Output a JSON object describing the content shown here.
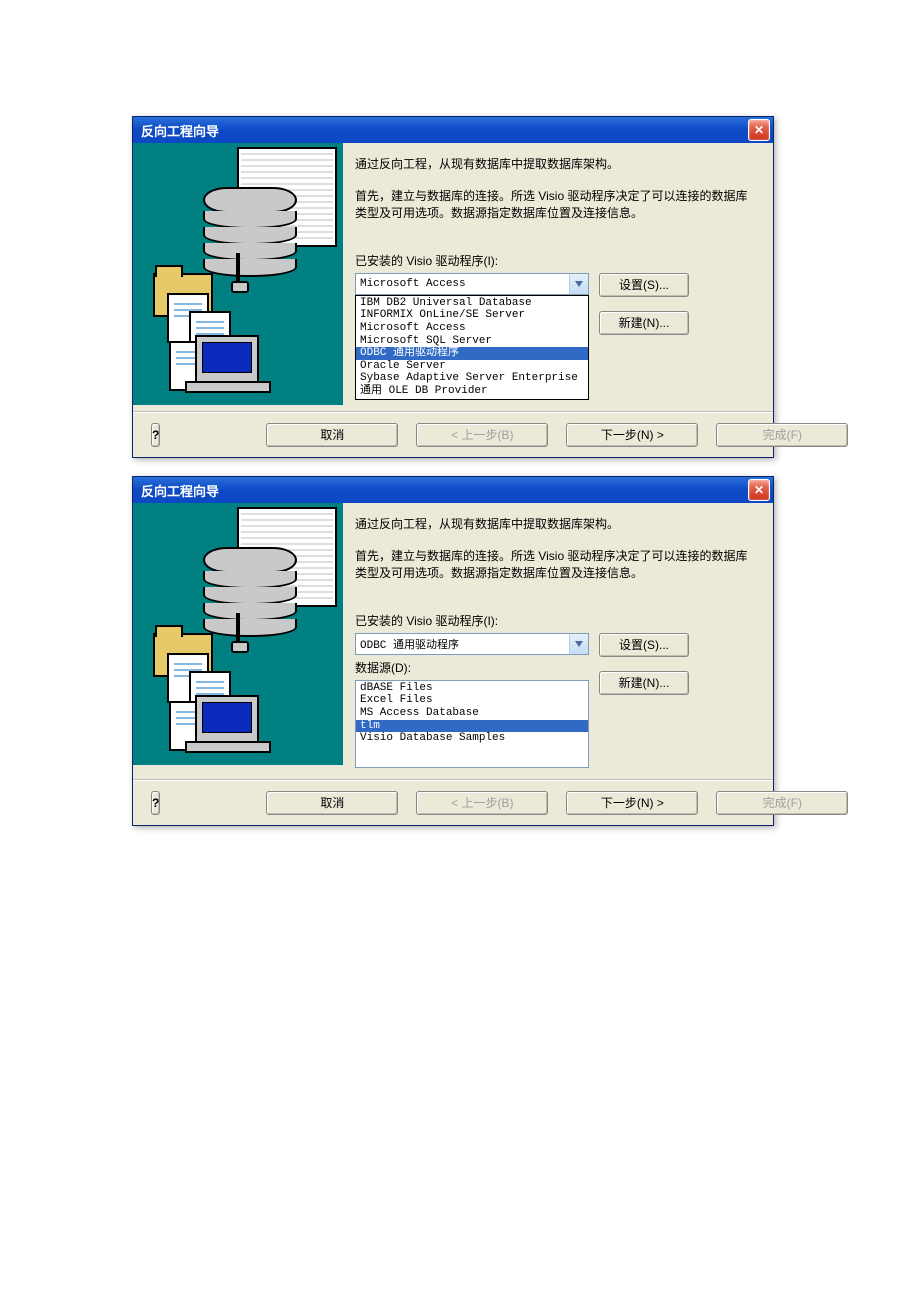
{
  "dialog1": {
    "title": "反向工程向导",
    "desc1": "通过反向工程，从现有数据库中提取数据库架构。",
    "desc2": "首先，建立与数据库的连接。所选 Visio 驱动程序决定了可以连接的数据库类型及可用选项。数据源指定数据库位置及连接信息。",
    "drivers_label": "已安装的 Visio 驱动程序(I):",
    "combo_value": "Microsoft Access",
    "drivers": [
      "IBM DB2 Universal Database",
      "INFORMIX OnLine/SE Server",
      "Microsoft Access",
      "Microsoft SQL Server",
      "ODBC 通用驱动程序",
      "Oracle Server",
      "Sybase Adaptive Server Enterprise",
      "通用 OLE DB Provider"
    ],
    "selected_driver_index": 4,
    "btn_setup": "设置(S)...",
    "btn_new": "新建(N)...",
    "footer": {
      "help": "?",
      "cancel": "取消",
      "back": "< 上一步(B)",
      "next": "下一步(N) >",
      "finish": "完成(F)"
    }
  },
  "dialog2": {
    "title": "反向工程向导",
    "desc1": "通过反向工程，从现有数据库中提取数据库架构。",
    "desc2": "首先，建立与数据库的连接。所选 Visio 驱动程序决定了可以连接的数据库类型及可用选项。数据源指定数据库位置及连接信息。",
    "drivers_label": "已安装的 Visio 驱动程序(I):",
    "combo_value": "ODBC 通用驱动程序",
    "datasource_label": "数据源(D):",
    "datasources": [
      "dBASE Files",
      "Excel Files",
      "MS Access Database",
      "tlm",
      "Visio Database Samples"
    ],
    "selected_ds_index": 3,
    "btn_setup": "设置(S)...",
    "btn_new": "新建(N)...",
    "footer": {
      "help": "?",
      "cancel": "取消",
      "back": "< 上一步(B)",
      "next": "下一步(N) >",
      "finish": "完成(F)"
    }
  }
}
